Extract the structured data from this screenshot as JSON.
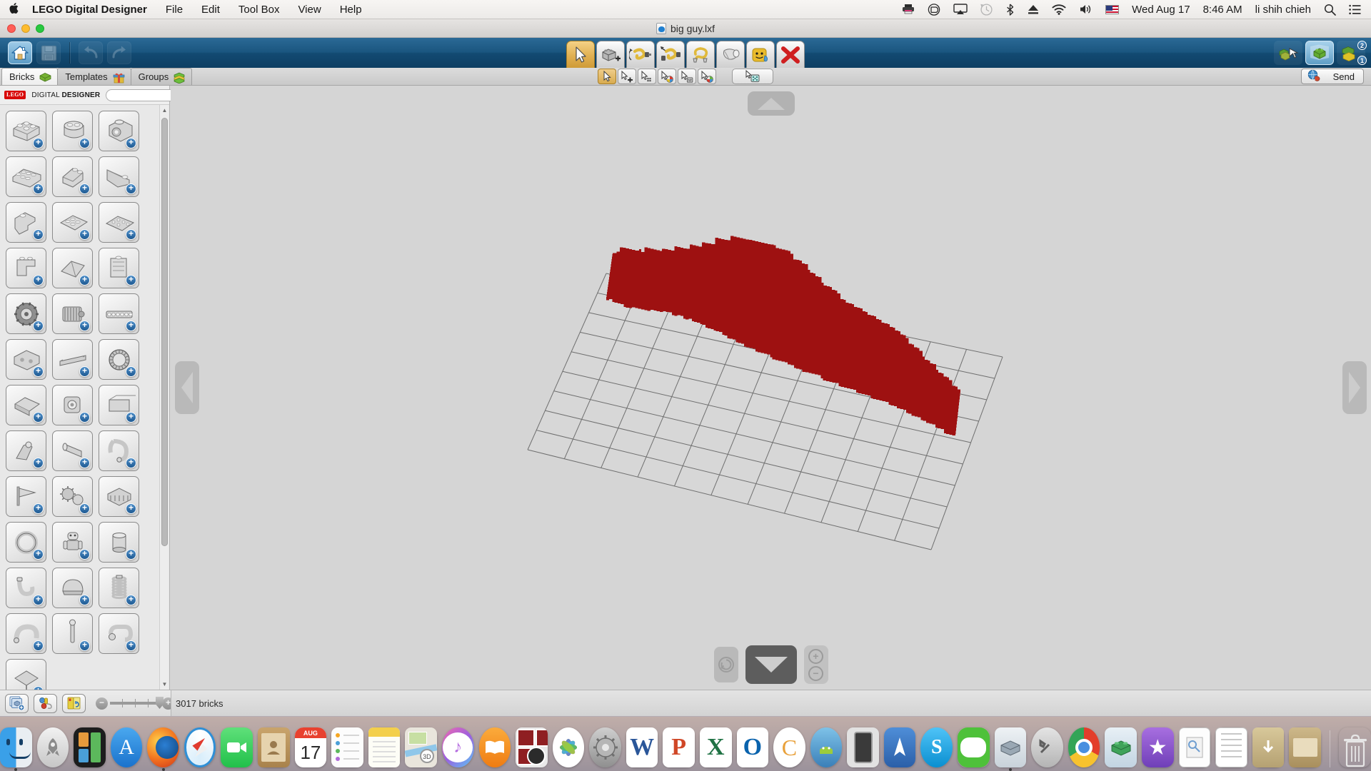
{
  "menubar": {
    "apple_glyph": "",
    "app_name": "LEGO Digital Designer",
    "items": [
      "File",
      "Edit",
      "Tool Box",
      "View",
      "Help"
    ],
    "status_icons": [
      "printer-icon",
      "dropbox-icon",
      "airplay-icon",
      "timemachine-icon",
      "bluetooth-icon",
      "eject-icon",
      "wifi-icon",
      "volume-icon",
      "us-flag-icon"
    ],
    "date": "Wed Aug 17",
    "time": "8:46 AM",
    "user": "li shih chieh",
    "search_glyph": "search-icon",
    "notification_glyph": "notification-center-icon"
  },
  "window": {
    "document_title": "big guy.lxf",
    "traffic_lights": [
      "close",
      "minimize",
      "zoom"
    ]
  },
  "toolbar": {
    "left_buttons": [
      {
        "name": "home-button",
        "label": "Home",
        "state": "active"
      },
      {
        "name": "save-button",
        "label": "Save",
        "state": "dimmed"
      }
    ],
    "history_buttons": [
      {
        "name": "undo-button",
        "label": "Undo",
        "state": "dimmed"
      },
      {
        "name": "redo-button",
        "label": "Redo",
        "state": "dimmed"
      }
    ],
    "center_tools": [
      {
        "name": "select-tool",
        "label": "Selection",
        "selected": true
      },
      {
        "name": "clone-tool",
        "label": "Clone",
        "selected": false
      },
      {
        "name": "hinge-tool",
        "label": "Hinge",
        "selected": false
      },
      {
        "name": "hinge-align-tool",
        "label": "Hinge Align",
        "selected": false
      },
      {
        "name": "flex-tool",
        "label": "Flex",
        "selected": false
      },
      {
        "name": "paint-tool",
        "label": "Paint",
        "selected": false
      },
      {
        "name": "color-picker-tool",
        "label": "Color Picker",
        "selected": false
      },
      {
        "name": "delete-tool",
        "label": "Delete",
        "selected": false
      }
    ],
    "right_tools": [
      {
        "name": "select-mode-button",
        "label": "Select Mode",
        "state": "off"
      },
      {
        "name": "build-mode-button",
        "label": "Build Mode",
        "state": "on"
      },
      {
        "name": "view-mode-button",
        "label": "View Mode",
        "state": "off",
        "badges": [
          "2",
          "1"
        ]
      }
    ]
  },
  "tabs": [
    {
      "name": "tab-bricks",
      "label": "Bricks",
      "icon": "green-brick-icon",
      "selected": true
    },
    {
      "name": "tab-templates",
      "label": "Templates",
      "icon": "gift-box-icon",
      "selected": false
    },
    {
      "name": "tab-groups",
      "label": "Groups",
      "icon": "stacked-bricks-icon",
      "selected": false
    }
  ],
  "selectbar": {
    "buttons": [
      {
        "name": "select-single-button",
        "label": "Select Single",
        "selected": true
      },
      {
        "name": "select-connected-button",
        "label": "Select Connected",
        "selected": false
      },
      {
        "name": "select-brick-type-button",
        "label": "Select Same Brick",
        "selected": false
      },
      {
        "name": "select-color-button",
        "label": "Select Same Color",
        "selected": false
      },
      {
        "name": "select-template-button",
        "label": "Select Template",
        "selected": false
      },
      {
        "name": "select-all-button",
        "label": "Select All",
        "selected": false
      }
    ],
    "extra_button": {
      "name": "random-select-button",
      "label": "Random"
    }
  },
  "send_button": {
    "label": "Send",
    "icon": "globe-upload-icon"
  },
  "palette": {
    "logo_text": "LEGO",
    "title_regular": "DIGITAL ",
    "title_bold": "DESIGNER",
    "search_value": "",
    "search_placeholder": "",
    "collapse_icon": "collapse-left-icon",
    "brick_count": 37,
    "bricks": [
      {
        "name": "brick-2x4",
        "label": "Brick 2x4"
      },
      {
        "name": "brick-round-2x2",
        "label": "Round Brick 2x2"
      },
      {
        "name": "brick-1x1-socket",
        "label": "Brick 1x1 with Socket"
      },
      {
        "name": "plate-2x6",
        "label": "Plate 2x6"
      },
      {
        "name": "slope-2x2",
        "label": "Slope Brick 2x2"
      },
      {
        "name": "wedge-plate",
        "label": "Wedge Plate"
      },
      {
        "name": "brick-corner",
        "label": "Corner Brick"
      },
      {
        "name": "plate-4x4",
        "label": "Plate 4x4"
      },
      {
        "name": "plate-studs",
        "label": "Plate with Studs"
      },
      {
        "name": "bracket-piece",
        "label": "Bracket"
      },
      {
        "name": "angled-plate",
        "label": "Angled Plate"
      },
      {
        "name": "panel-1x4x3",
        "label": "Panel 1x4x3"
      },
      {
        "name": "technic-gear",
        "label": "Technic Gear"
      },
      {
        "name": "technic-motor",
        "label": "Technic Motor"
      },
      {
        "name": "technic-beam",
        "label": "Technic Beam"
      },
      {
        "name": "technic-brick",
        "label": "Technic Brick"
      },
      {
        "name": "technic-axle",
        "label": "Technic Axle"
      },
      {
        "name": "technic-turntable",
        "label": "Technic Turntable"
      },
      {
        "name": "technic-liftarm",
        "label": "Technic Liftarm"
      },
      {
        "name": "technic-connector",
        "label": "Technic Connector"
      },
      {
        "name": "technic-panel",
        "label": "Technic Panel"
      },
      {
        "name": "wrench-tool-part",
        "label": "Wrench"
      },
      {
        "name": "tube-part",
        "label": "Tube"
      },
      {
        "name": "horseshoe-part",
        "label": "Horseshoe"
      },
      {
        "name": "flag-part",
        "label": "Flag"
      },
      {
        "name": "gears-part",
        "label": "Gears"
      },
      {
        "name": "grille-part",
        "label": "Grille"
      },
      {
        "name": "ring-part",
        "label": "Ring"
      },
      {
        "name": "minifig-part",
        "label": "Minifigure"
      },
      {
        "name": "barrel-part",
        "label": "Barrel"
      },
      {
        "name": "hook-part",
        "label": "Hook"
      },
      {
        "name": "helmet-part",
        "label": "Helmet"
      },
      {
        "name": "spring-part",
        "label": "Spring"
      },
      {
        "name": "curved-part",
        "label": "Curved Piece"
      },
      {
        "name": "antenna-part",
        "label": "Antenna"
      },
      {
        "name": "clip-part",
        "label": "Clip"
      },
      {
        "name": "misc-part",
        "label": "Misc Part"
      }
    ]
  },
  "canvas": {
    "nav": {
      "up": "rotate-up-button",
      "down": "rotate-down-button",
      "left": "rotate-left-button",
      "right": "rotate-right-button",
      "reset": "reset-view-button",
      "zoom_in": "+",
      "zoom_out": "−"
    },
    "model": {
      "name": "big-guy-model",
      "color": "#9e1111",
      "baseplate_color": "#d7d7d7",
      "grid_line_color": "#6f6f6f"
    }
  },
  "statusbar": {
    "buttons": [
      {
        "name": "new-model-button",
        "label": "New Model Group"
      },
      {
        "name": "color-palette-button",
        "label": "Color Palette"
      },
      {
        "name": "brick-info-button",
        "label": "Brick Info"
      }
    ],
    "zoom": {
      "name": "palette-zoom-slider",
      "min_icon": "−",
      "max_icon": "+",
      "value": 85
    },
    "bricks_label": "3017 bricks"
  },
  "dock": {
    "items": [
      {
        "name": "dock-finder",
        "label": "Finder",
        "running": true
      },
      {
        "name": "dock-launchpad",
        "label": "Launchpad",
        "running": false
      },
      {
        "name": "dock-mission-control",
        "label": "Mission Control",
        "running": false
      },
      {
        "name": "dock-app-store",
        "label": "App Store",
        "running": false
      },
      {
        "name": "dock-firefox",
        "label": "Firefox",
        "running": true
      },
      {
        "name": "dock-safari",
        "label": "Safari",
        "running": false
      },
      {
        "name": "dock-facetime",
        "label": "FaceTime",
        "running": false
      },
      {
        "name": "dock-contacts",
        "label": "Contacts",
        "running": false
      },
      {
        "name": "dock-calendar",
        "label": "Calendar",
        "running": false
      },
      {
        "name": "dock-reminders",
        "label": "Reminders",
        "running": false
      },
      {
        "name": "dock-notes",
        "label": "Notes",
        "running": false
      },
      {
        "name": "dock-maps",
        "label": "Maps",
        "running": false
      },
      {
        "name": "dock-itunes",
        "label": "iTunes",
        "running": false
      },
      {
        "name": "dock-ibooks",
        "label": "iBooks",
        "running": false
      },
      {
        "name": "dock-photo-booth",
        "label": "Photo Booth",
        "running": false
      },
      {
        "name": "dock-photos",
        "label": "Photos",
        "running": false
      },
      {
        "name": "dock-system-preferences",
        "label": "System Preferences",
        "running": false
      },
      {
        "name": "dock-word",
        "label": "Microsoft Word",
        "running": false
      },
      {
        "name": "dock-powerpoint",
        "label": "Microsoft PowerPoint",
        "running": false
      },
      {
        "name": "dock-excel",
        "label": "Microsoft Excel",
        "running": false
      },
      {
        "name": "dock-outlook",
        "label": "Microsoft Outlook",
        "running": false
      },
      {
        "name": "dock-chrome-canary",
        "label": "Chrome Canary",
        "running": false
      },
      {
        "name": "dock-android-studio",
        "label": "Android Studio",
        "running": false
      },
      {
        "name": "dock-simulator",
        "label": "Simulator",
        "running": false
      },
      {
        "name": "dock-xcode",
        "label": "Xcode",
        "running": false
      },
      {
        "name": "dock-skype",
        "label": "Skype",
        "running": false
      },
      {
        "name": "dock-line",
        "label": "LINE",
        "running": false
      },
      {
        "name": "dock-lego-digital-designer",
        "label": "LEGO Digital Designer",
        "running": true
      },
      {
        "name": "dock-utility",
        "label": "Utility",
        "running": false
      },
      {
        "name": "dock-chrome",
        "label": "Google Chrome",
        "running": false
      },
      {
        "name": "dock-lego-brick",
        "label": "LEGO Brick",
        "running": false
      },
      {
        "name": "dock-star-app",
        "label": "Star App",
        "running": false
      },
      {
        "name": "dock-preview",
        "label": "Preview",
        "running": false
      },
      {
        "name": "dock-textedit",
        "label": "TextEdit",
        "running": false
      },
      {
        "name": "dock-downloads",
        "label": "Downloads",
        "running": false
      },
      {
        "name": "dock-documents-folder",
        "label": "Documents",
        "running": false
      },
      {
        "name": "dock-trash",
        "label": "Trash",
        "running": false
      }
    ]
  },
  "colors": {
    "model_red": "#9e1111",
    "toolbar_blue": "#15517c",
    "accent_gold": "#d9ae51",
    "lego_red": "#d80a0a"
  }
}
